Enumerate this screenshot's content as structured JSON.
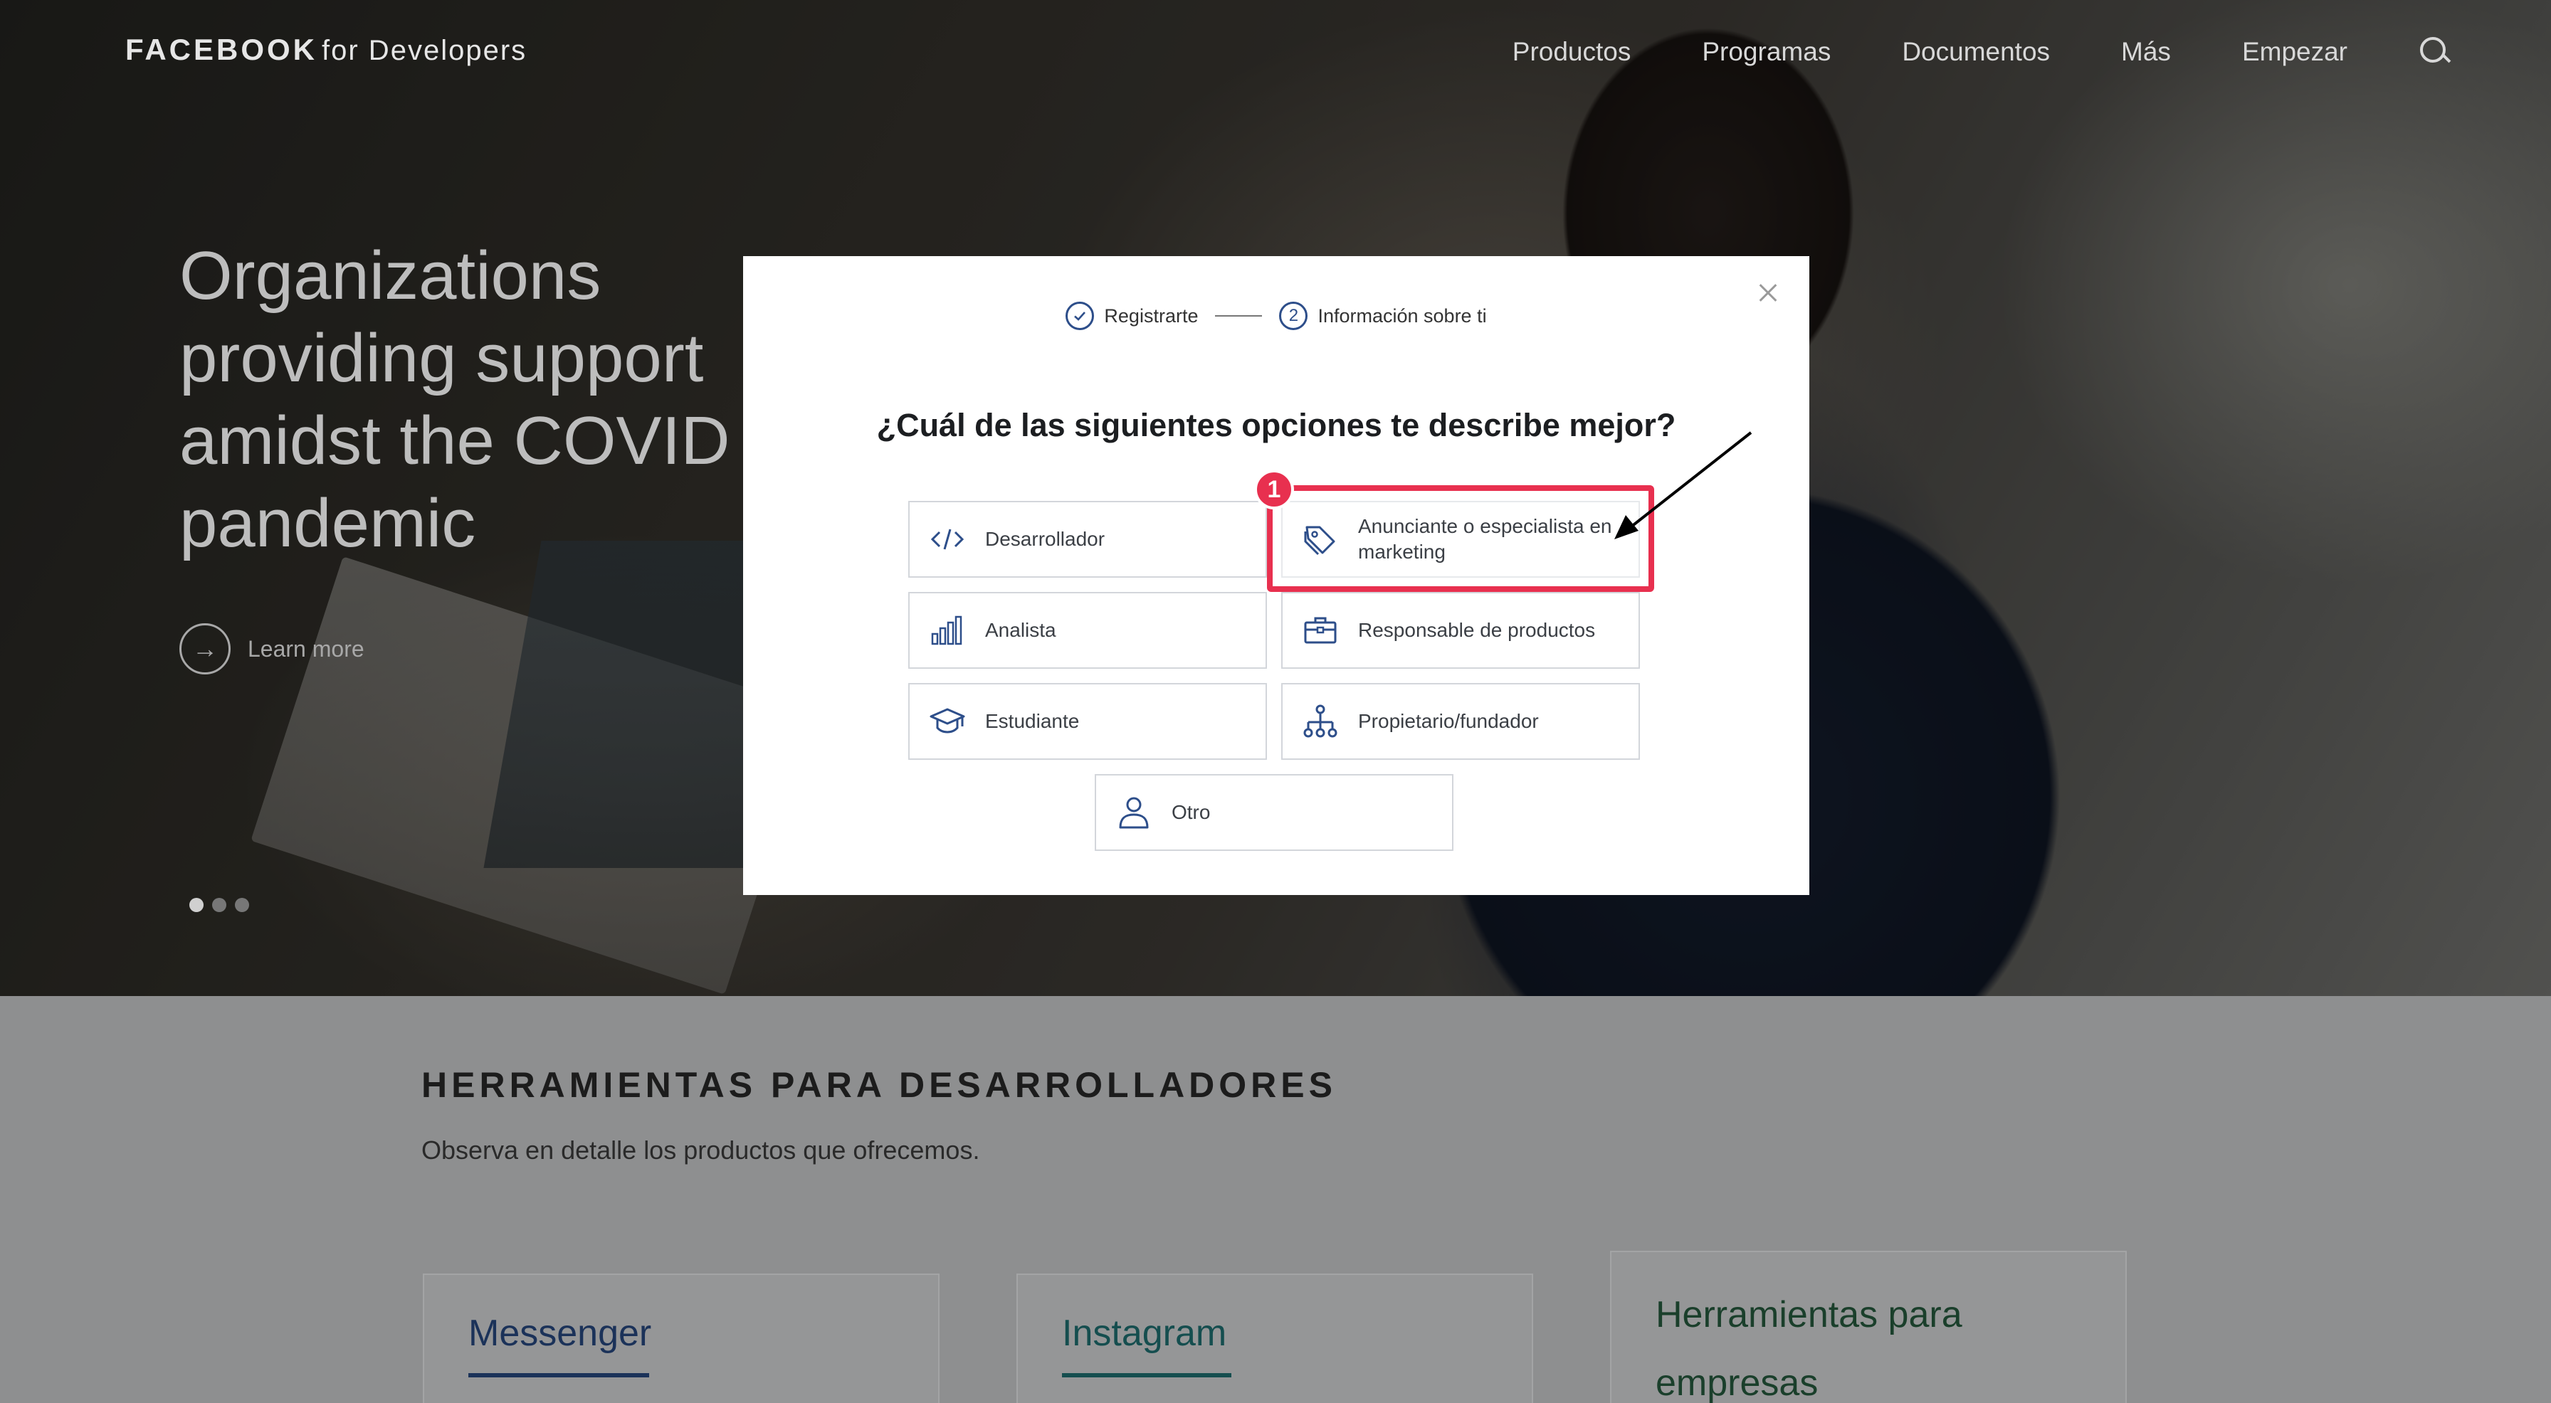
{
  "header": {
    "logo_main": "FACEBOOK",
    "logo_sub": "for Developers",
    "nav": [
      "Productos",
      "Programas",
      "Documentos",
      "Más",
      "Empezar"
    ]
  },
  "hero": {
    "title": "Organizations\nproviding support\namidst the COVID\npandemic",
    "learn_more": "Learn more"
  },
  "modal": {
    "steps": [
      {
        "label": "Registrarte",
        "state": "done"
      },
      {
        "number": "2",
        "label": "Información sobre ti",
        "state": "current"
      }
    ],
    "question": "¿Cuál de las siguientes opciones te describe mejor?",
    "options": [
      {
        "label": "Desarrollador",
        "icon": "code-icon"
      },
      {
        "label": "Anunciante o especialista en marketing",
        "icon": "tag-icon"
      },
      {
        "label": "Analista",
        "icon": "bar-chart-icon"
      },
      {
        "label": "Responsable de productos",
        "icon": "briefcase-icon"
      },
      {
        "label": "Estudiante",
        "icon": "graduation-cap-icon"
      },
      {
        "label": "Propietario/fundador",
        "icon": "org-chart-icon"
      },
      {
        "label": "Otro",
        "icon": "person-icon"
      }
    ]
  },
  "annotation": {
    "badge": "1"
  },
  "section": {
    "title": "HERRAMIENTAS PARA DESARROLLADORES",
    "subtitle": "Observa en detalle los productos que ofrecemos.",
    "cards": [
      "Messenger",
      "Instagram",
      "Herramientas para empresas"
    ]
  },
  "colors": {
    "accent": "#2d4e8a",
    "annotation": "#e8304f"
  }
}
